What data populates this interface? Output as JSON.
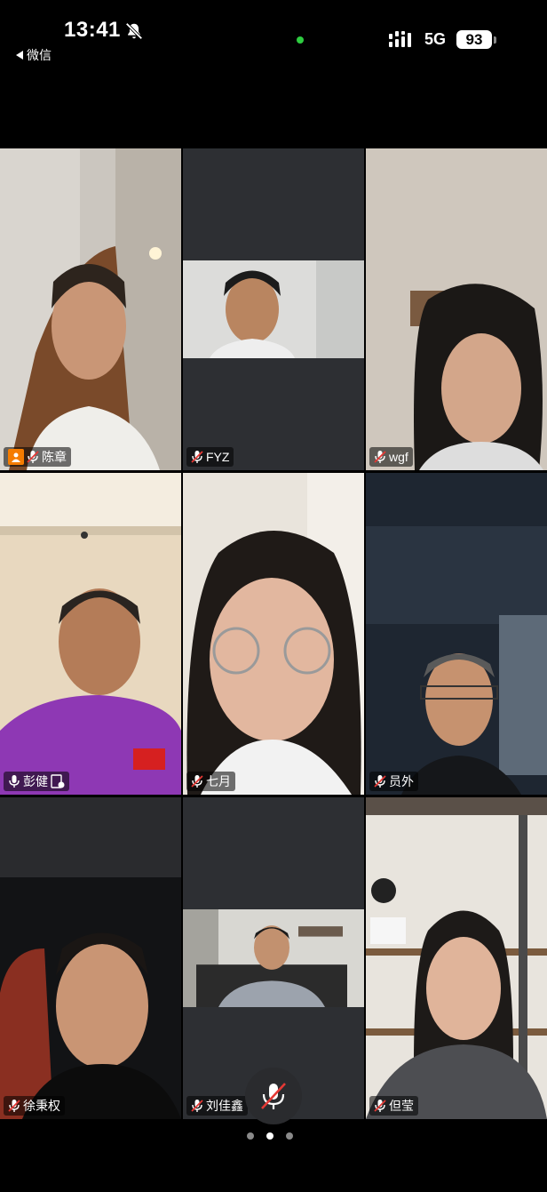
{
  "status_bar": {
    "time": "13:41",
    "back_label": "微信",
    "network": "5G",
    "battery": "93"
  },
  "participants": [
    {
      "name": "陈章",
      "host": true,
      "muted": true
    },
    {
      "name": "FYZ",
      "muted": true
    },
    {
      "name": "wgf",
      "muted": true
    },
    {
      "name": "彭健",
      "muted": false,
      "speaking": true,
      "sharing": true
    },
    {
      "name": "七月",
      "muted": true
    },
    {
      "name": "员外",
      "muted": true
    },
    {
      "name": "徐秉权",
      "muted": true
    },
    {
      "name": "刘佳鑫",
      "muted": true
    },
    {
      "name": "但莹",
      "muted": true
    }
  ],
  "controls": {
    "mic_state": "muted"
  },
  "pager": {
    "pages": 3,
    "current": 2
  },
  "colors": {
    "speaking_border": "#22c55e",
    "host_badge": "#f57c00",
    "tile_bg": "#2d2f33"
  }
}
